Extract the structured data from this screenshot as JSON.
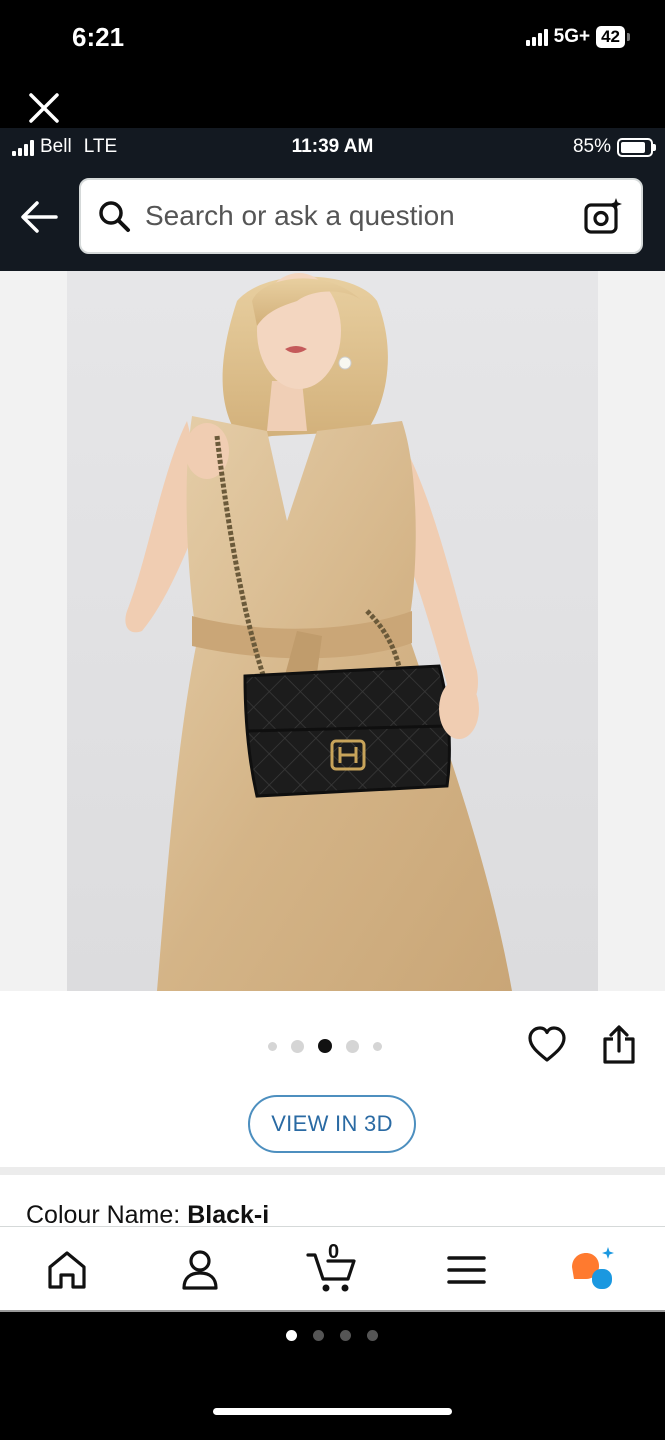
{
  "os_status": {
    "time": "6:21",
    "network": "5G+",
    "battery": "42"
  },
  "app_status": {
    "carrier": "Bell",
    "network": "LTE",
    "time": "11:39 AM",
    "battery": "85%"
  },
  "search": {
    "placeholder": "Search or ask a question"
  },
  "product": {
    "image_count": 5,
    "current_image_index": 2,
    "view_3d_label": "VIEW IN 3D",
    "colour_label": "Colour Name:",
    "colour_value": "Black-i"
  },
  "bottom_nav": {
    "items": [
      "home-icon",
      "account-icon",
      "cart-icon",
      "menu-icon",
      "rufus-icon"
    ],
    "cart_count": "0"
  },
  "page_dots": {
    "count": 4,
    "active_index": 0
  },
  "colors": {
    "app_header": "#131921",
    "view3d_border": "#4d8fbf",
    "accent_orange": "#ff7a2f",
    "accent_blue": "#1b98e0"
  }
}
